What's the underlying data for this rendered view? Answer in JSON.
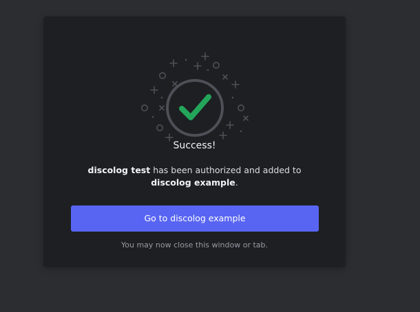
{
  "card": {
    "title": "Success!",
    "message": {
      "app_name": "discolog test",
      "middle_text": " has been authorized and added to ",
      "server_name": "discolog example",
      "end_text": "."
    },
    "button": {
      "prefix": "Go to ",
      "server_name": "discolog example"
    },
    "hint": "You may now close this window or tab."
  },
  "colors": {
    "background": "#2b2d31",
    "card": "#1e1f22",
    "accent": "#5865f2",
    "success": "#23a55a"
  },
  "icons": {
    "success": "checkmark-icon",
    "decoration": "sparkle-icon"
  }
}
